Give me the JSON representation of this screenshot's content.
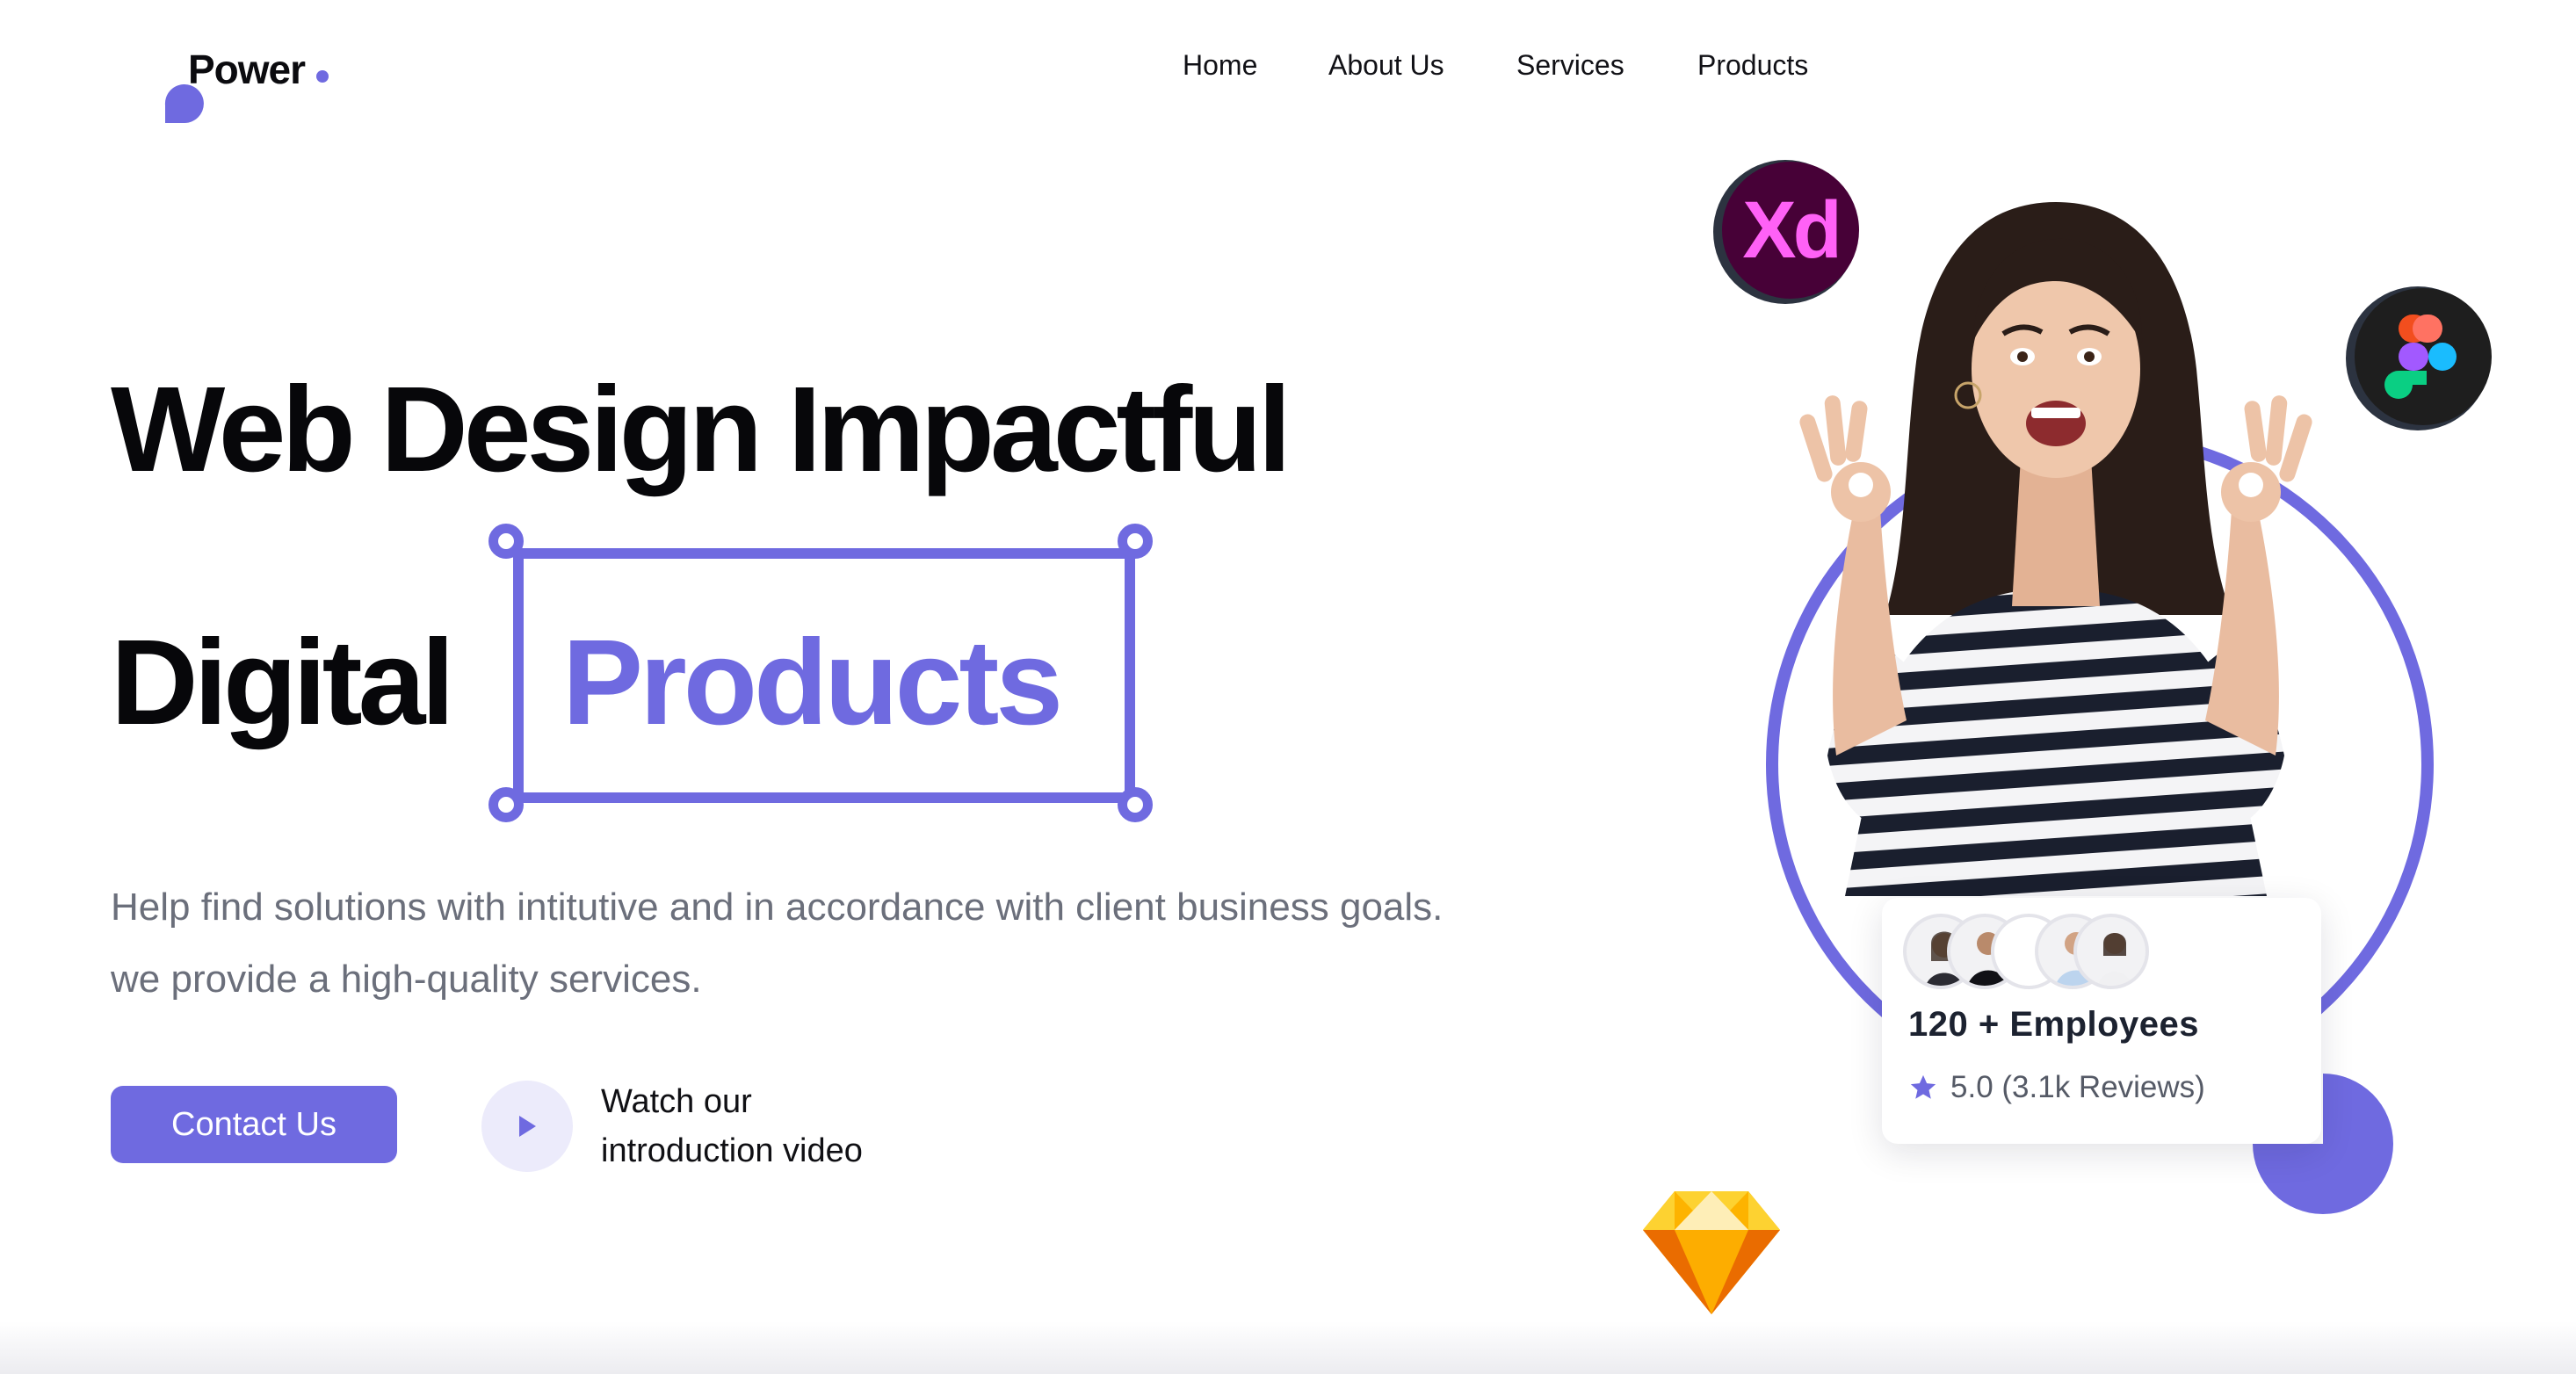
{
  "brand": {
    "name": "Power",
    "accent_color": "#6f6ae0",
    "accent_light": "#ecebfb",
    "logo_mark_icon": "quarter-circle-icon",
    "logo_dot_icon": "dot-icon"
  },
  "nav": {
    "items": [
      {
        "label": "Home"
      },
      {
        "label": "About Us"
      },
      {
        "label": "Services"
      },
      {
        "label": "Products"
      }
    ]
  },
  "hero": {
    "headline_line1": "Web Design Impactful",
    "headline_line2_start": "Digital",
    "headline_highlight": "Products",
    "subtext": "Help find solutions with intitutive and in accordance with client business goals. we provide a high-quality services.",
    "cta_label": "Contact Us",
    "video_line1": "Watch our",
    "video_line2": "introduction video",
    "play_icon": "play-icon"
  },
  "visual": {
    "tool_icons": [
      "adobe-xd-icon",
      "figma-icon",
      "sketch-icon"
    ],
    "xd_label": "Xd",
    "person": "woman-ok-gesture-image",
    "decorations": [
      "accent-ring",
      "quarter-circle-shape"
    ]
  },
  "employees_card": {
    "count_label": "120 + Employees",
    "rating": "5.0 (3.1k Reviews)",
    "rating_icon": "star-icon",
    "avatar_count": 5
  }
}
